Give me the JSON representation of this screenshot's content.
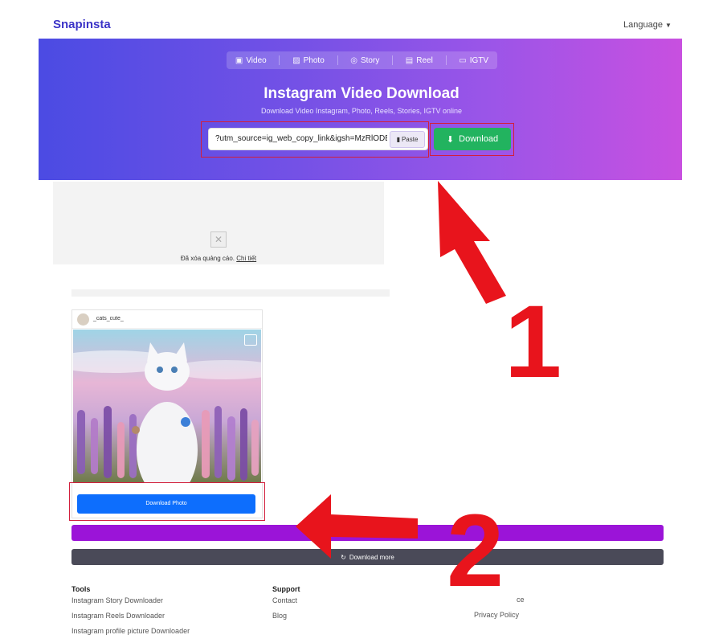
{
  "header": {
    "logo": "Snapinsta",
    "language": "Language"
  },
  "tabs": [
    {
      "label": "Video",
      "icon": "video-icon"
    },
    {
      "label": "Photo",
      "icon": "photo-icon"
    },
    {
      "label": "Story",
      "icon": "story-icon"
    },
    {
      "label": "Reel",
      "icon": "reel-icon"
    },
    {
      "label": "IGTV",
      "icon": "igtv-icon"
    }
  ],
  "hero": {
    "title": "Instagram Video Download",
    "subtitle": "Download Video Instagram, Photo, Reels, Stories, IGTV online",
    "url_value": "?utm_source=ig_web_copy_link&igsh=MzRlODBiN",
    "paste_label": "Paste",
    "download_label": "Download"
  },
  "ad": {
    "text": "Đã xóa quảng cáo.",
    "link": "Chi tiết"
  },
  "result": {
    "username": "_cats_cute_",
    "download_photo_label": "Download Photo",
    "download_more_label": "Download more"
  },
  "footer": {
    "tools_heading": "Tools",
    "tools_items": [
      "Instagram Story Downloader",
      "Instagram Reels Downloader",
      "Instagram profile picture Downloader"
    ],
    "support_heading": "Support",
    "support_items": [
      "Contact",
      "Blog"
    ],
    "legal_items": [
      "ce",
      "Privacy Policy"
    ]
  },
  "annotations": {
    "step1": "1",
    "step2": "2",
    "color": "#e8141c"
  },
  "colors": {
    "brand": "#3b33c7",
    "download_green": "#22b35f",
    "primary_blue": "#0d6efd",
    "purple_bar": "#9b14d8"
  }
}
